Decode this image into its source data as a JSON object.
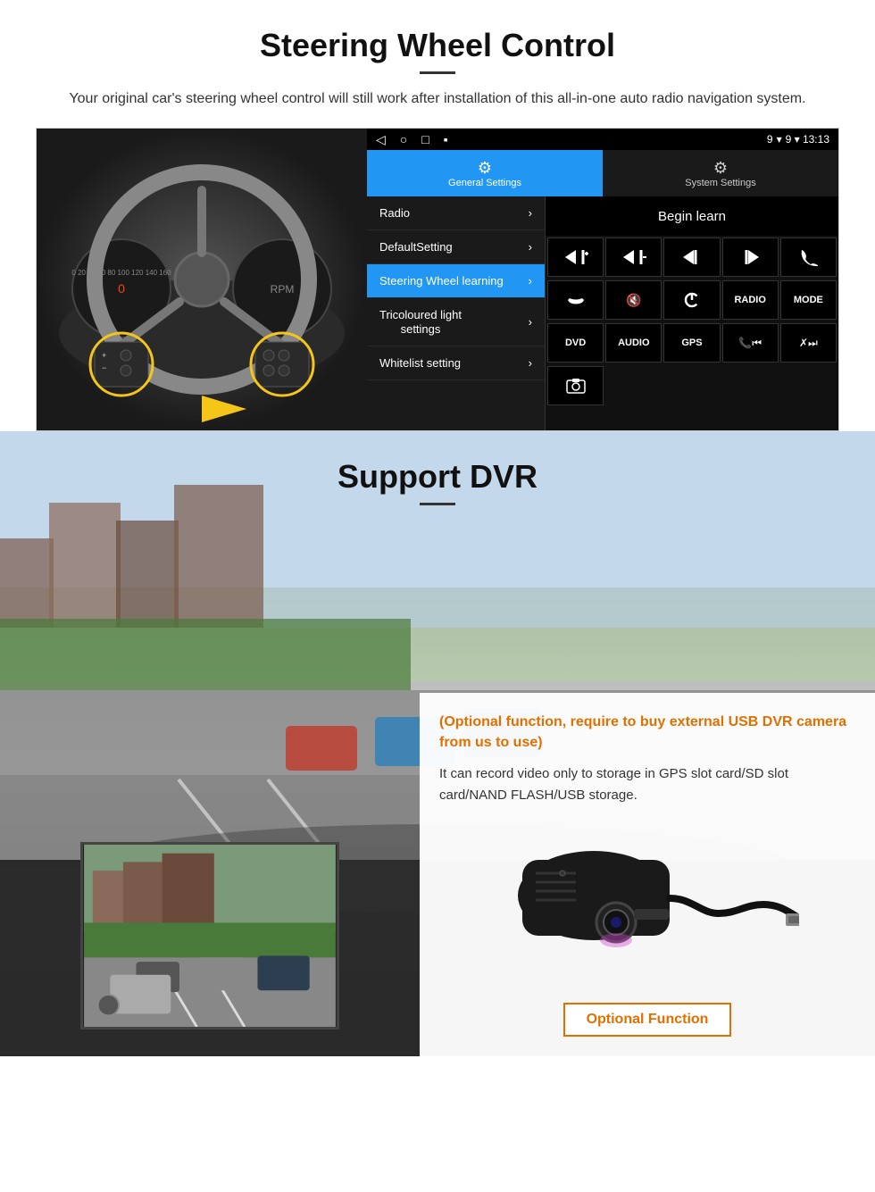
{
  "steering": {
    "title": "Steering Wheel Control",
    "description": "Your original car's steering wheel control will still work after installation of this all-in-one auto radio navigation system.",
    "statusbar": {
      "nav_icons": [
        "◁",
        "○",
        "□",
        "▪"
      ],
      "right_icons": "9 ▾ 13:13"
    },
    "tabs": {
      "general": {
        "icon": "⚙",
        "label": "General Settings"
      },
      "system": {
        "icon": "⛵",
        "label": "System Settings"
      }
    },
    "menu": {
      "items": [
        {
          "label": "Radio",
          "active": false
        },
        {
          "label": "DefaultSetting",
          "active": false
        },
        {
          "label": "Steering Wheel learning",
          "active": true
        },
        {
          "label": "Tricoloured light settings",
          "active": false
        },
        {
          "label": "Whitelist setting",
          "active": false
        }
      ]
    },
    "begin_learn": "Begin learn",
    "control_buttons": [
      {
        "label": "⏮+",
        "type": "icon"
      },
      {
        "label": "⏮−",
        "type": "icon"
      },
      {
        "label": "⏮",
        "type": "icon"
      },
      {
        "label": "⏭",
        "type": "icon"
      },
      {
        "label": "📞",
        "type": "icon"
      },
      {
        "label": "↩",
        "type": "icon"
      },
      {
        "label": "🔇",
        "type": "icon"
      },
      {
        "label": "⏻",
        "type": "icon"
      },
      {
        "label": "RADIO",
        "type": "text"
      },
      {
        "label": "MODE",
        "type": "text"
      },
      {
        "label": "DVD",
        "type": "text"
      },
      {
        "label": "AUDIO",
        "type": "text"
      },
      {
        "label": "GPS",
        "type": "text"
      },
      {
        "label": "📞⏮",
        "type": "icon"
      },
      {
        "label": "✗⏭",
        "type": "icon"
      },
      {
        "label": "📷",
        "type": "icon"
      }
    ]
  },
  "dvr": {
    "title": "Support DVR",
    "optional_text": "(Optional function, require to buy external USB DVR camera from us to use)",
    "description": "It can record video only to storage in GPS slot card/SD slot card/NAND FLASH/USB storage.",
    "optional_button": "Optional Function"
  }
}
